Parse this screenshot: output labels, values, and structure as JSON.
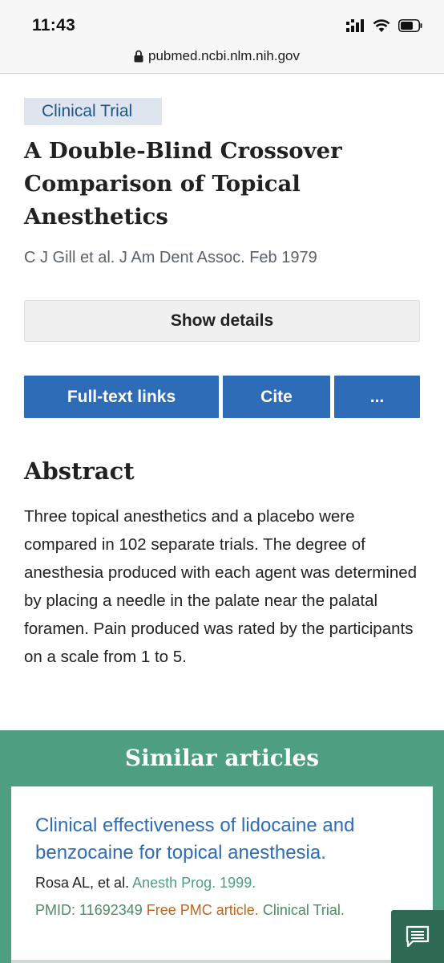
{
  "status_bar": {
    "time": "11:43",
    "icons": [
      "signal-icon",
      "wifi-icon",
      "battery-icon"
    ]
  },
  "browser": {
    "url": "pubmed.ncbi.nlm.nih.gov",
    "lock_icon": "lock-icon"
  },
  "article": {
    "type_badge": "Clinical Trial",
    "title": "A Double-Blind Crossover Comparison of Topical Anesthetics",
    "citation": "C J Gill et al. J Am Dent Assoc. Feb 1979",
    "show_details_label": "Show details",
    "actions": {
      "full_text_label": "Full-text links",
      "cite_label": "Cite",
      "more_label": "..."
    }
  },
  "abstract": {
    "heading": "Abstract",
    "text": "Three topical anesthetics and a placebo were compared in 102 separate trials. The degree of anesthesia produced with each agent was determined by placing a needle in the palate near the palatal foramen. Pain produced was rated by the participants on a scale from 1 to 5."
  },
  "similar_articles": {
    "heading": "Similar articles",
    "items": [
      {
        "title": "Clinical effectiveness of lidocaine and benzocaine for topical anesthesia.",
        "authors": "Rosa AL, et al.",
        "journal": "Anesth Prog. 1999.",
        "pmid": "PMID: 11692349",
        "free_pmc": "Free PMC article.",
        "type": "Clinical Trial."
      }
    ]
  },
  "feedback_icon": "feedback-icon",
  "colors": {
    "accent_blue": "#2e6cb8",
    "similar_green": "#4e9f82",
    "badge_bg": "#dfe5ee",
    "pmc_orange": "#c0641a"
  }
}
